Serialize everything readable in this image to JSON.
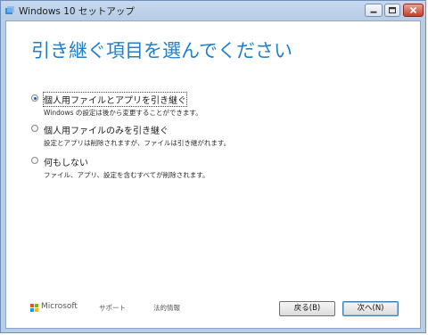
{
  "window": {
    "title": "Windows 10 セットアップ"
  },
  "page": {
    "heading": "引き継ぐ項目を選んでください"
  },
  "options": [
    {
      "label": "個人用ファイルとアプリを引き継ぐ",
      "description": "Windows の設定は後から変更することができます。",
      "selected": true
    },
    {
      "label": "個人用ファイルのみを引き継ぐ",
      "description": "設定とアプリは削除されますが、ファイルは引き継がれます。",
      "selected": false
    },
    {
      "label": "何もしない",
      "description": "ファイル、アプリ、設定を含むすべてが削除されます。",
      "selected": false
    }
  ],
  "footer": {
    "brand": "Microsoft",
    "support_link": "サポート",
    "legal_link": "法的情報",
    "back_button": "戻る(B)",
    "next_button": "次へ(N)"
  },
  "colors": {
    "heading": "#1f7fcb",
    "titlebar": "#c6d9ef",
    "ms_red": "#f25022",
    "ms_green": "#7fba00",
    "ms_blue": "#00a4ef",
    "ms_yellow": "#ffb900"
  }
}
